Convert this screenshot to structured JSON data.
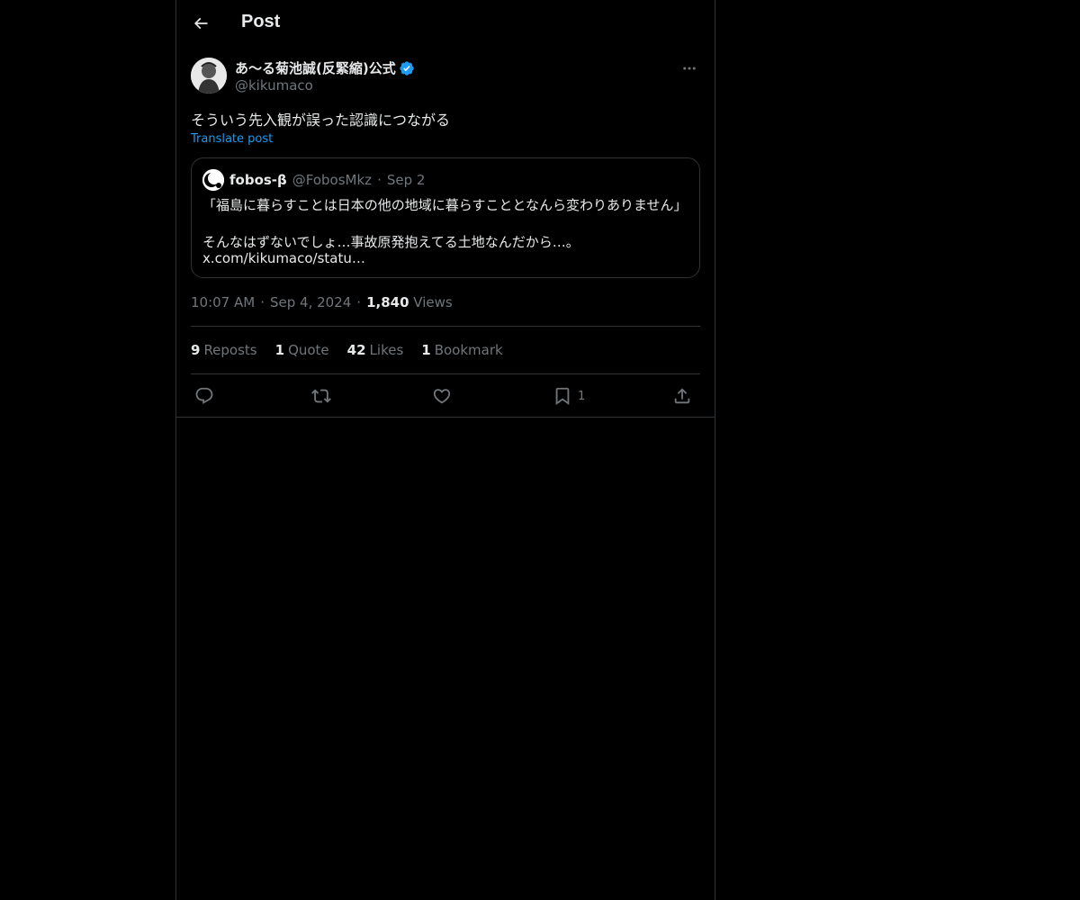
{
  "header": {
    "title": "Post"
  },
  "author": {
    "display_name": "あ〜る菊池誠(反緊縮)公式",
    "handle": "@kikumaco",
    "verified": true
  },
  "post": {
    "text": "そういう先入観が誤った認識につながる",
    "translate_label": "Translate post"
  },
  "quote": {
    "name": "fobos-β",
    "handle": "@FobosMkz",
    "separator": "·",
    "date": "Sep 2",
    "line1": "「福島に暮らすことは日本の他の地域に暮らすこととなんら変わりありません」",
    "line2": "そんなはずないでしょ…事故原発抱えてる土地なんだから…。",
    "link": "x.com/kikumaco/statu…"
  },
  "meta": {
    "time": "10:07 AM",
    "sep1": "·",
    "date": "Sep 4, 2024",
    "sep2": "·",
    "views_count": "1,840",
    "views_label": "Views"
  },
  "stats": [
    {
      "num": "9",
      "label": "Reposts"
    },
    {
      "num": "1",
      "label": "Quote"
    },
    {
      "num": "42",
      "label": "Likes"
    },
    {
      "num": "1",
      "label": "Bookmark"
    }
  ],
  "actions": {
    "bookmark_count": "1"
  },
  "colors": {
    "background": "#000000",
    "text": "#e7e9ea",
    "muted": "#71767b",
    "accent": "#1d9bf0",
    "border": "#2f3336"
  },
  "icons": [
    "back-arrow-icon",
    "verified-badge-icon",
    "more-icon",
    "reply-icon",
    "repost-icon",
    "like-icon",
    "bookmark-icon",
    "share-icon"
  ]
}
